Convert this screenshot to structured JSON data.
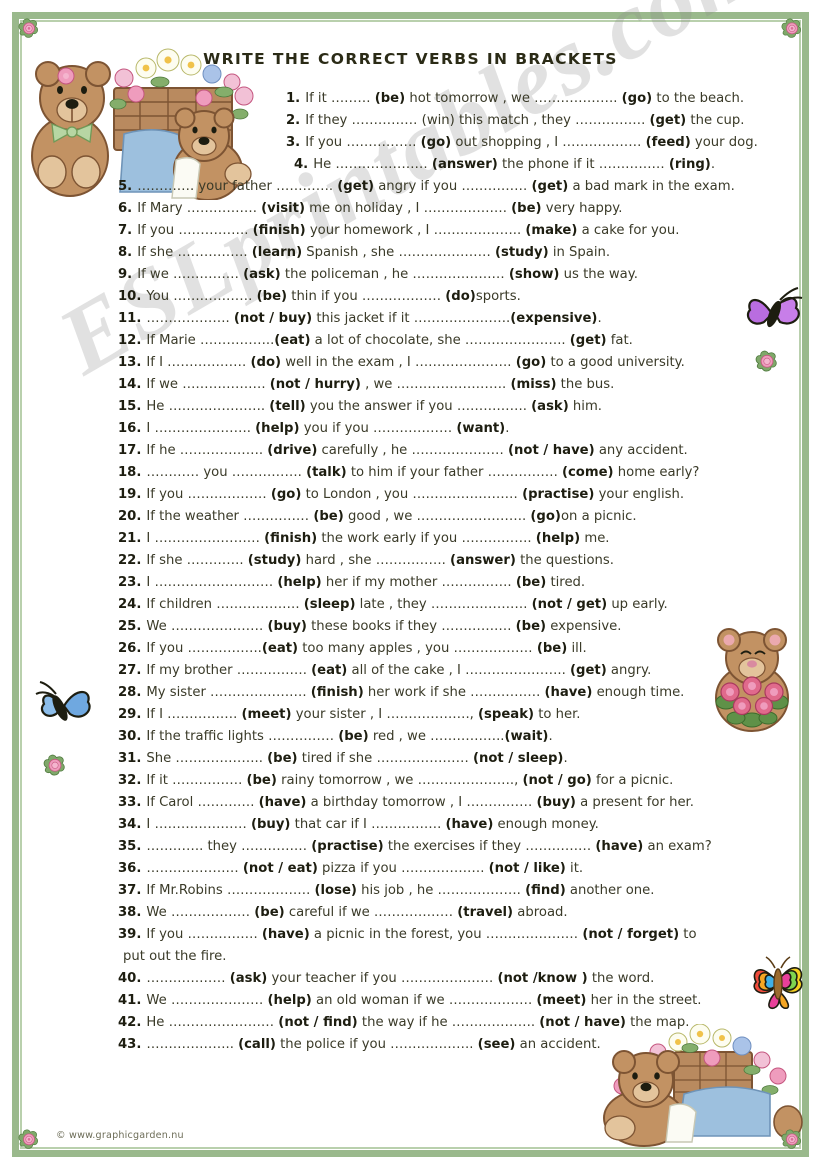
{
  "title": "WRITE THE CORRECT VERBS IN BRACKETS",
  "watermark": "ESLprintables.com",
  "footer": "© www.graphicgarden.nu",
  "colors": {
    "border_green": "#9ab98c",
    "border_light_green": "#b9d0ad",
    "text": "#3a3a28",
    "bold_text": "#1d1d10",
    "rose_pink": "#e87fa6",
    "bear_brown": "#b08157",
    "cart_blue": "#8fb6d8",
    "butterfly_purple": "#b46bd8",
    "butterfly_blue": "#6fa8e0"
  },
  "exercises": [
    {
      "num": "1.",
      "indent": 1,
      "text": "If it ……… <b>(be)</b> hot tomorrow , we ………………. <b>(go)</b> to the beach."
    },
    {
      "num": "2.",
      "indent": 1,
      "text": "If they …………… (win) this match , they ……………. <b>(get)</b> the cup."
    },
    {
      "num": "3.",
      "indent": 1,
      "text": "If you ……………. <b>(go)</b> out shopping , I ……………… <b>(feed)</b> your dog."
    },
    {
      "num": "4.",
      "indent": 4,
      "text": "He ………………… <b>(answer)</b> the phone if it …………… <b>(ring)</b>."
    },
    {
      "num": "5.",
      "indent": 0,
      "text": "…………. your father …………. <b>(get)</b> angry if you …………… <b>(get)</b> a bad mark in the exam."
    },
    {
      "num": "6.",
      "indent": 0,
      "text": "If Mary ……………. <b>(visit)</b> me on holiday , I ………………. <b>(be)</b> very happy."
    },
    {
      "num": "7.",
      "indent": 0,
      "text": "If you ……………. <b>(finish)</b> your homework , I ……………….. <b>(make)</b> a cake for you."
    },
    {
      "num": "8.",
      "indent": 0,
      "text": "If she ……………. <b>(learn)</b> Spanish , she ………………… <b>(study)</b> in Spain."
    },
    {
      "num": "9.",
      "indent": 0,
      "text": "If we …………… <b>(ask)</b> the policeman , he ………………… <b>(show)</b> us the way."
    },
    {
      "num": "10.",
      "indent": 0,
      "text": "You ……………… <b>(be)</b> thin if you ……………… <b>(do)</b>sports."
    },
    {
      "num": "11.",
      "indent": 0,
      "text": "………………. <b>(not / buy)</b> this jacket if it ………………….<b>(expensive)</b>."
    },
    {
      "num": "12.",
      "indent": 0,
      "text": "If Marie ……………..<b>(eat)</b> a lot of chocolate, she ………………….. <b>(get)</b> fat."
    },
    {
      "num": "13.",
      "indent": 0,
      "text": "If I ……………… <b>(do)</b> well in the exam , I …………………. <b>(go)</b> to a good university."
    },
    {
      "num": "14.",
      "indent": 0,
      "text": "If we ………………. <b>(not / hurry)</b> , we ……………………. <b>(miss)</b> the bus."
    },
    {
      "num": "15.",
      "indent": 0,
      "text": "He …………………. <b>(tell)</b> you the answer  if you ……………. <b>(ask)</b> him."
    },
    {
      "num": "16.",
      "indent": 0,
      "text": "I …………………. <b>(help)</b> you if you ……………… <b>(want)</b>."
    },
    {
      "num": "17.",
      "indent": 0,
      "text": "If he ………………. <b>(drive)</b> carefully , he ………………… <b>(not / have)</b> any accident."
    },
    {
      "num": "18.",
      "indent": 0,
      "text": "………… you ……………. <b>(talk)</b> to him if your father ……………. <b>(come)</b> home early?"
    },
    {
      "num": "19.",
      "indent": 0,
      "text": "If you ……………… <b>(go)</b> to London , you …………………… <b>(practise)</b> your english."
    },
    {
      "num": "20.",
      "indent": 0,
      "text": "If the weather …………… <b>(be)</b> good , we ……………………. <b>(go)</b>on a picnic."
    },
    {
      "num": "21.",
      "indent": 0,
      "text": "I …………………… <b>(finish)</b> the work early if you ……………. <b>(help)</b> me."
    },
    {
      "num": "22.",
      "indent": 0,
      "text": "If she …………. <b>(study)</b> hard , she ……………. <b>(answer)</b> the questions."
    },
    {
      "num": "23.",
      "indent": 0,
      "text": "I ……………………… <b>(help)</b> her  if my mother ……………. <b>(be)</b> tired."
    },
    {
      "num": "24.",
      "indent": 0,
      "text": "If children ………………. <b>(sleep)</b> late , they …………………. <b>(not / get)</b> up early."
    },
    {
      "num": "25.",
      "indent": 0,
      "text": "We ………………… <b>(buy)</b> these books  if they ……………. <b>(be)</b> expensive."
    },
    {
      "num": "26.",
      "indent": 0,
      "text": "If you ……………..<b>(eat)</b> too many apples , you ……………… <b>(be)</b> ill."
    },
    {
      "num": "27.",
      "indent": 0,
      "text": "If my brother ……………. <b>(eat)</b> all of the cake , I ………………….. <b>(get)</b> angry."
    },
    {
      "num": "28.",
      "indent": 0,
      "text": "My sister …………………. <b>(finish)</b> her work if she ……………. <b>(have)</b> enough time."
    },
    {
      "num": "29.",
      "indent": 0,
      "text": "If I ……………. <b>(meet)</b> your sister , I ………………., <b>(speak)</b> to her."
    },
    {
      "num": "30.",
      "indent": 0,
      "text": "If the traffic lights …………… <b>(be)</b> red , we ……………..<b>(wait)</b>."
    },
    {
      "num": "31.",
      "indent": 0,
      "text": "She ……………….. <b>(be)</b> tired if she ………………… <b>(not / sleep)</b>."
    },
    {
      "num": "32.",
      "indent": 0,
      "text": "If it ……………. <b>(be)</b> rainy tomorrow , we …………………., <b>(not / go)</b> for a picnic."
    },
    {
      "num": "33.",
      "indent": 0,
      "text": "If Carol …………. <b>(have)</b> a birthday tomorrow , I …………… <b>(buy)</b> a present for her."
    },
    {
      "num": "34.",
      "indent": 0,
      "text": "I ………………… <b>(buy)</b> that car  if I ……………. <b>(have)</b> enough money."
    },
    {
      "num": "35.",
      "indent": 0,
      "text": "…………. they …………… <b>(practise)</b> the exercises if they …………… <b>(have)</b> an exam?"
    },
    {
      "num": "36.",
      "indent": 0,
      "text": "………………… <b>(not / eat)</b> pizza if you ………………. <b>(not / like)</b> it."
    },
    {
      "num": "37.",
      "indent": 0,
      "text": "If Mr.Robins ………………. <b>(lose)</b> his job , he ………………. <b>(find)</b> another one."
    },
    {
      "num": "38.",
      "indent": 0,
      "text": "We ……………… <b>(be)</b> careful if we ……………… <b>(travel)</b> abroad."
    },
    {
      "num": "39.",
      "indent": 0,
      "text": "If you ……………. <b>(have)</b> a picnic in the forest, you ………………… <b>(not / forget)</b> to"
    },
    {
      "num": "",
      "indent": 0,
      "continuation": true,
      "text": "put out the fire."
    },
    {
      "num": "40.",
      "indent": 0,
      "text": "……………… <b>(ask)</b> your teacher if you ………………… <b>(not /know )</b> the word."
    },
    {
      "num": "41.",
      "indent": 0,
      "text": "We ………………… <b>(help)</b> an old woman if we ………………. <b>(meet)</b> her in the street."
    },
    {
      "num": "42.",
      "indent": 0,
      "text": "He …………………… <b>(not / find)</b> the way if he ………………. <b>(not / have)</b> the map."
    },
    {
      "num": "43.",
      "indent": 0,
      "text": "……………….. <b>(call)</b> the police if you ………………. <b>(see)</b> an accident."
    }
  ],
  "clipart": [
    {
      "name": "teddy-bears-flower-cart-top-left"
    },
    {
      "name": "purple-butterfly-right"
    },
    {
      "name": "rose-right-upper"
    },
    {
      "name": "blue-butterfly-left"
    },
    {
      "name": "rose-left-lower"
    },
    {
      "name": "teddy-bear-with-roses-right"
    },
    {
      "name": "rainbow-butterfly-bottom-right"
    },
    {
      "name": "teddy-bear-flower-cart-bottom-right"
    }
  ]
}
